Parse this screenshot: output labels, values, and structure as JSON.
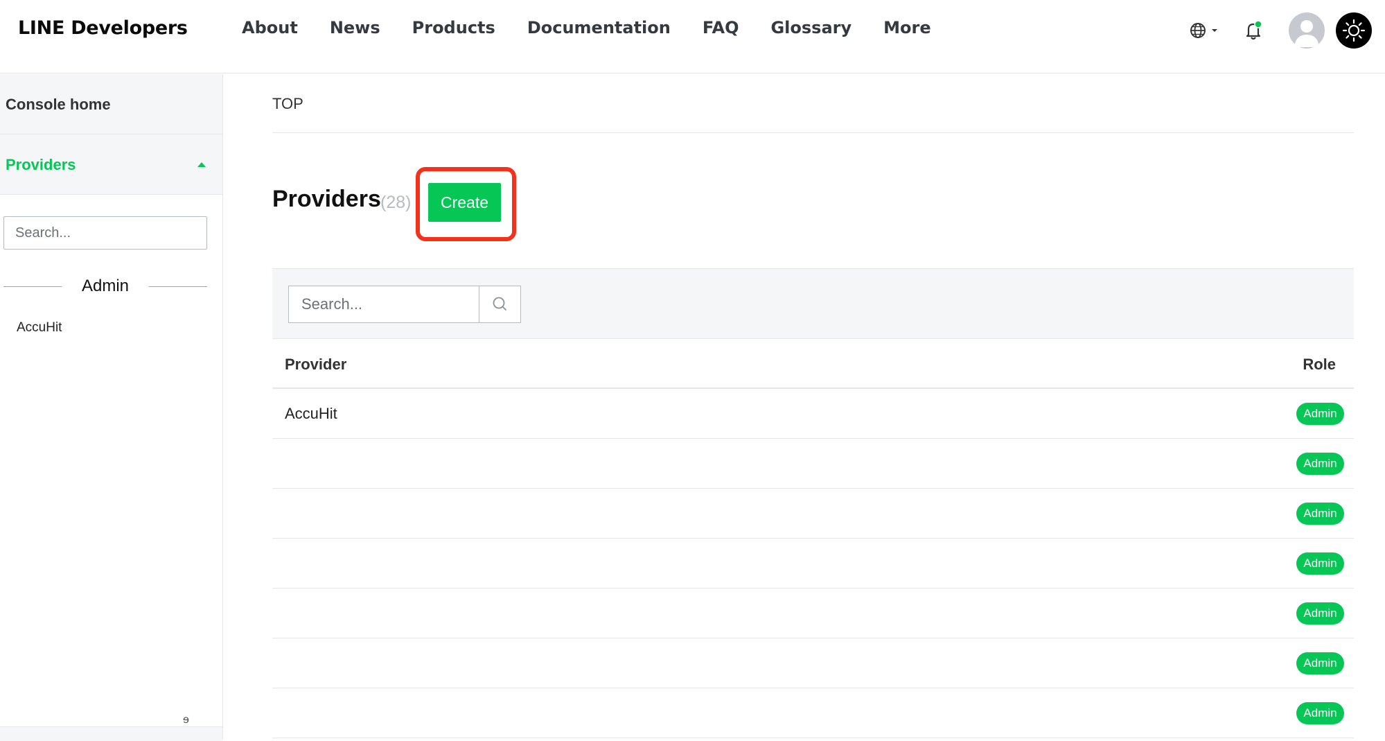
{
  "header": {
    "brand": "LINE Developers",
    "nav": [
      "About",
      "News",
      "Products",
      "Documentation",
      "FAQ",
      "Glossary",
      "More"
    ],
    "icons": [
      "globe-icon",
      "chevron-down-icon",
      "bell-icon",
      "avatar",
      "sun-icon"
    ],
    "notification_dot_color": "#06c755"
  },
  "sidebar": {
    "console_home": "Console home",
    "providers_label": "Providers",
    "search_placeholder": "Search...",
    "section_label": "Admin",
    "providers": [
      "AccuHit"
    ],
    "stray_glyph": "ɘ"
  },
  "main": {
    "breadcrumb": "TOP",
    "title": "Providers",
    "count": "(28)",
    "create_label": "Create",
    "search_placeholder": "Search...",
    "table": {
      "columns": [
        "Provider",
        "Role"
      ],
      "rows": [
        {
          "name": "AccuHit",
          "role": "Admin"
        },
        {
          "name": "",
          "role": "Admin"
        },
        {
          "name": "",
          "role": "Admin"
        },
        {
          "name": "",
          "role": "Admin"
        },
        {
          "name": "",
          "role": "Admin"
        },
        {
          "name": "",
          "role": "Admin"
        },
        {
          "name": "",
          "role": "Admin"
        }
      ]
    }
  },
  "colors": {
    "accent": "#06c755",
    "highlight": "#f5301c",
    "panel_bg": "#f5f6f7",
    "divider": "#e4e6e8"
  }
}
